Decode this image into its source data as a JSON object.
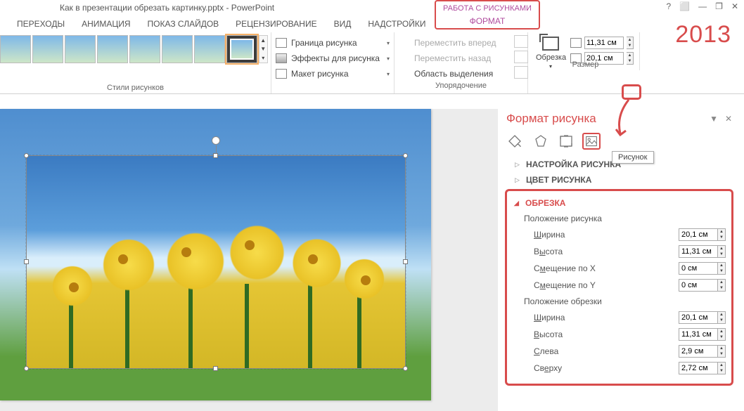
{
  "app": {
    "title": "Как в презентации обрезать картинку.pptx - PowerPoint",
    "version_stamp": "2013"
  },
  "contextual": {
    "group": "РАБОТА С РИСУНКАМИ",
    "tab": "ФОРМАТ"
  },
  "win": {
    "help": "?",
    "full": "⬜",
    "min": "—",
    "restore": "❐",
    "close": "✕"
  },
  "tabs": [
    "ПЕРЕХОДЫ",
    "АНИМАЦИЯ",
    "ПОКАЗ СЛАЙДОВ",
    "РЕЦЕНЗИРОВАНИЕ",
    "ВИД",
    "НАДСТРОЙКИ"
  ],
  "ribbon": {
    "styles_label": "Стили рисунков",
    "fmt": {
      "border": "Граница рисунка",
      "effects": "Эффекты для рисунка",
      "layout": "Макет рисунка"
    },
    "arrange": {
      "forward": "Переместить вперед",
      "back": "Переместить назад",
      "selpane": "Область выделения",
      "label": "Упорядочение"
    },
    "size": {
      "crop": "Обрезка",
      "height": "11,31 см",
      "width": "20,1 см",
      "label": "Размер"
    }
  },
  "pane": {
    "title": "Формат рисунка",
    "tooltip": "Рисунок",
    "sections": {
      "adjust": "НАСТРОЙКА РИСУНКА",
      "color": "ЦВЕТ РИСУНКА",
      "crop": "ОБРЕЗКА"
    },
    "picpos_label": "Положение рисунка",
    "croppos_label": "Положение обрезки",
    "labels": {
      "width": "Ширина",
      "height": "Высота",
      "offx": "Смещение по X",
      "offy": "Смещение по Y",
      "left": "Слева",
      "top": "Сверху"
    },
    "values": {
      "pic_w": "20,1 см",
      "pic_h": "11,31 см",
      "off_x": "0 см",
      "off_y": "0 см",
      "crop_w": "20,1 см",
      "crop_h": "11,31 см",
      "crop_l": "2,9 см",
      "crop_t": "2,72 см"
    }
  }
}
